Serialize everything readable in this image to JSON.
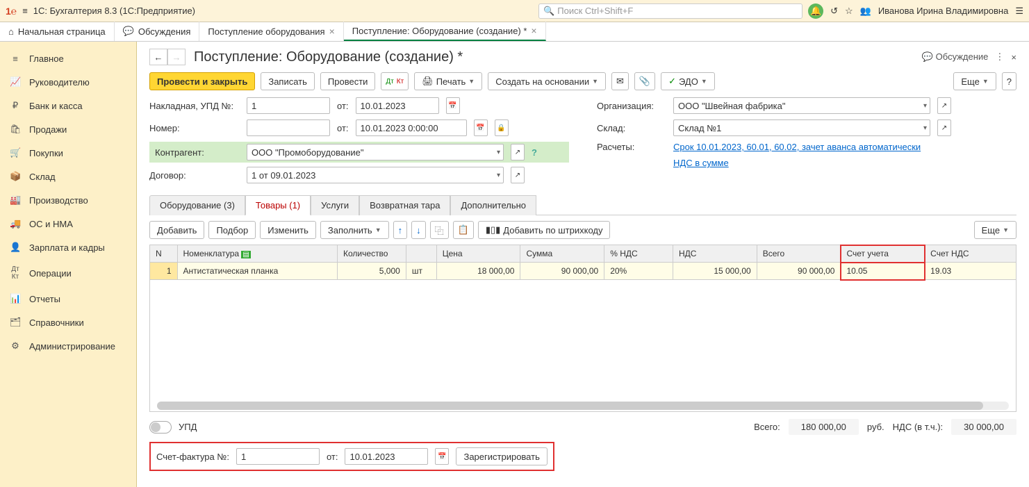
{
  "topbar": {
    "app_title": "1С: Бухгалтерия 8.3  (1С:Предприятие)",
    "search_placeholder": "Поиск Ctrl+Shift+F",
    "user": "Иванова Ирина Владимировна"
  },
  "tabs": [
    {
      "label": "Начальная страница",
      "closable": false
    },
    {
      "label": "Обсуждения",
      "closable": false
    },
    {
      "label": "Поступление оборудования",
      "closable": true
    },
    {
      "label": "Поступление: Оборудование (создание) *",
      "closable": true,
      "active": true
    }
  ],
  "sidebar": [
    {
      "label": "Главное"
    },
    {
      "label": "Руководителю"
    },
    {
      "label": "Банк и касса"
    },
    {
      "label": "Продажи"
    },
    {
      "label": "Покупки"
    },
    {
      "label": "Склад"
    },
    {
      "label": "Производство"
    },
    {
      "label": "ОС и НМА"
    },
    {
      "label": "Зарплата и кадры"
    },
    {
      "label": "Операции"
    },
    {
      "label": "Отчеты"
    },
    {
      "label": "Справочники"
    },
    {
      "label": "Администрирование"
    }
  ],
  "page": {
    "title": "Поступление: Оборудование (создание) *",
    "discuss": "Обсуждение"
  },
  "toolbar": {
    "post_close": "Провести и закрыть",
    "save": "Записать",
    "post": "Провести",
    "print": "Печать",
    "create_based": "Создать на основании",
    "edo": "ЭДО",
    "more": "Еще"
  },
  "form": {
    "invoice_no_label": "Накладная, УПД №:",
    "invoice_no": "1",
    "from": "от:",
    "date1": "10.01.2023",
    "number_label": "Номер:",
    "date2": "10.01.2023  0:00:00",
    "org_label": "Организация:",
    "org": "ООО \"Швейная фабрика\"",
    "warehouse_label": "Склад:",
    "warehouse": "Склад №1",
    "contractor_label": "Контрагент:",
    "contractor": "ООО \"Промоборудование\"",
    "contract_label": "Договор:",
    "contract": "1 от 09.01.2023",
    "calc_label": "Расчеты:",
    "calc_link": "Срок 10.01.2023, 60.01, 60.02, зачет аванса автоматически",
    "vat_link": "НДС в сумме"
  },
  "subtabs": [
    {
      "label": "Оборудование (3)"
    },
    {
      "label": "Товары (1)",
      "active": true
    },
    {
      "label": "Услуги"
    },
    {
      "label": "Возвратная тара"
    },
    {
      "label": "Дополнительно"
    }
  ],
  "grid_toolbar": {
    "add": "Добавить",
    "select": "Подбор",
    "edit": "Изменить",
    "fill": "Заполнить",
    "barcode": "Добавить по штрихкоду",
    "more": "Еще"
  },
  "table": {
    "headers": [
      "N",
      "Номенклатура",
      "Количество",
      "",
      "Цена",
      "Сумма",
      "% НДС",
      "НДС",
      "Всего",
      "Счет учета",
      "Счет НДС"
    ],
    "rows": [
      {
        "n": "1",
        "name": "Антистатическая планка",
        "qty": "5,000",
        "unit": "шт",
        "price": "18 000,00",
        "sum": "90 000,00",
        "vat_pct": "20%",
        "vat": "15 000,00",
        "total": "90 000,00",
        "acct": "10.05",
        "vat_acct": "19.03"
      }
    ]
  },
  "bottom": {
    "upd": "УПД",
    "total_label": "Всего:",
    "total": "180 000,00",
    "currency": "руб.",
    "vat_incl_label": "НДС (в т.ч.):",
    "vat_incl": "30 000,00",
    "sf_label": "Счет-фактура №:",
    "sf_no": "1",
    "sf_from": "от:",
    "sf_date": "10.01.2023",
    "register": "Зарегистрировать"
  }
}
